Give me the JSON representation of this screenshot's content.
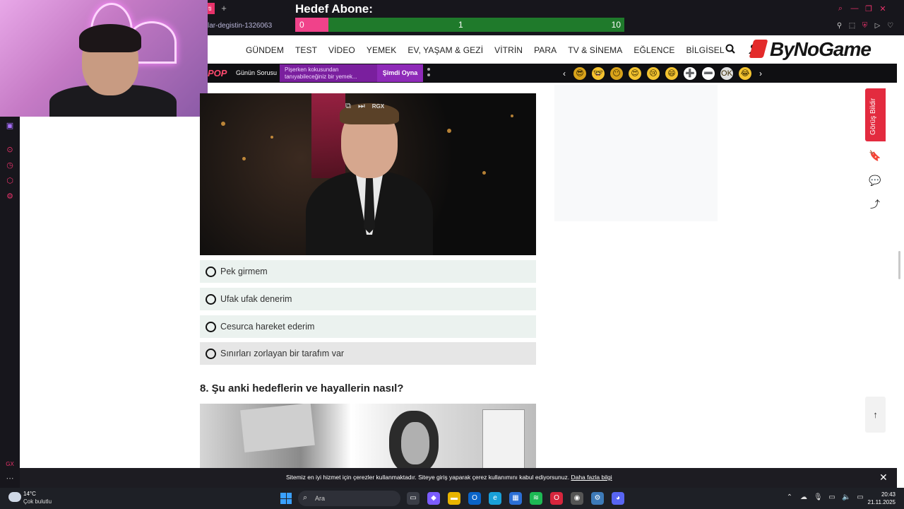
{
  "browser": {
    "tab_fragment": "ti",
    "new_tab": "+",
    "url_fragment": "lar-degistin-1326063",
    "window_controls": [
      "search-icon",
      "minimize-icon",
      "restore-icon",
      "close-icon"
    ],
    "address_icons": [
      "pin-icon",
      "snapshot-icon",
      "shield-icon",
      "play-icon",
      "heart-icon"
    ]
  },
  "stream_overlay": {
    "goal_title": "Hedef Abone:",
    "goal_current": "0",
    "goal_mid": "1",
    "goal_max": "10",
    "goal_progress_fraction": 0.1,
    "colors": {
      "fill": "#f0428a",
      "track": "#1f7a2b"
    }
  },
  "site": {
    "logo": "ByNoGame",
    "nav": [
      "GÜNDEM",
      "TEST",
      "VİDEO",
      "YEMEK",
      "EV, YAŞAM & GEZİ",
      "VİTRİN",
      "PARA",
      "TV & SİNEMA",
      "EĞLENCE",
      "BİLGİSEL"
    ],
    "promo": {
      "brand": "POP",
      "daily_question": "Günün Sorusu",
      "question_text": "Pişerken kokusundan tanıyabileceğiniz bir yemek...",
      "play_button": "Şimdi Oyna"
    },
    "emoji_reactions": [
      "😎",
      "🤓",
      "😶",
      "😍",
      "😢",
      "😄",
      "➕",
      "➖",
      "OK",
      "😂"
    ]
  },
  "quiz": {
    "gif_controls": {
      "rgx_label": "RGX"
    },
    "options": [
      {
        "label": "Pek girmem"
      },
      {
        "label": "Ufak ufak denerim"
      },
      {
        "label": "Cesurca hareket ederim"
      },
      {
        "label": "Sınırları zorlayan bir tarafım var"
      }
    ],
    "next_question": "8. Şu anki hedeflerin ve hayallerin nasıl?"
  },
  "sidebar": {
    "feedback": "Görüş Bildir",
    "to_top": "↑"
  },
  "cookie": {
    "text": "Sitemiz en iyi hizmet için çerezler kullanmaktadır. Siteye giriş yaparak çerez kullanımını kabul ediyorsunuz.",
    "link": "Daha fazla bilgi",
    "close": "✕"
  },
  "taskbar": {
    "weather_temp": "14°C",
    "weather_desc": "Çok bulutlu",
    "search_placeholder": "Ara",
    "time": "20:43",
    "date": "21.11.2025"
  }
}
